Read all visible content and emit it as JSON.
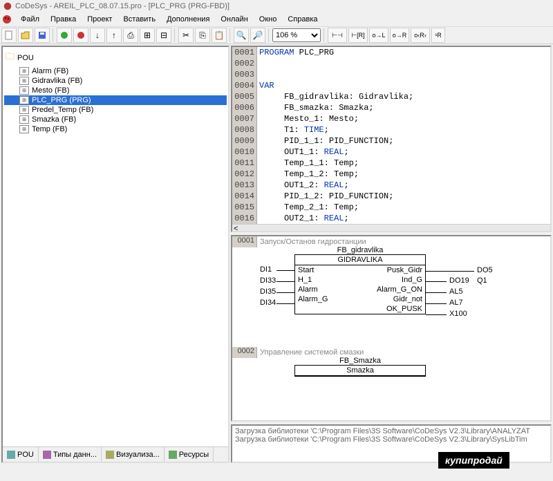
{
  "title": "CoDeSys - AREIL_PLC_08.07.15.pro - [PLC_PRG (PRG-FBD)]",
  "menu": [
    "Файл",
    "Правка",
    "Проект",
    "Вставить",
    "Дополнения",
    "Онлайн",
    "Окно",
    "Справка"
  ],
  "zoom": "106 %",
  "tree": {
    "root": "POU",
    "items": [
      "Alarm (FB)",
      "Gidravlika (FB)",
      "Mesto (FB)",
      "PLC_PRG (PRG)",
      "Predel_Temp (FB)",
      "Smazka (FB)",
      "Temp (FB)"
    ],
    "selected": 3
  },
  "btabs": [
    "POU",
    "Типы данн...",
    "Визуализа...",
    "Ресурсы"
  ],
  "code": [
    {
      "n": "0001",
      "tokens": [
        {
          "t": "PROGRAM",
          "c": "kw"
        },
        {
          "t": " PLC_PRG",
          "c": "tx"
        }
      ]
    },
    {
      "n": "0002",
      "tokens": []
    },
    {
      "n": "0003",
      "tokens": []
    },
    {
      "n": "0004",
      "tokens": [
        {
          "t": "VAR",
          "c": "kw"
        }
      ]
    },
    {
      "n": "0005",
      "tokens": [
        {
          "t": "     FB_gidravlika: Gidravlika;",
          "c": "tx"
        }
      ]
    },
    {
      "n": "0006",
      "tokens": [
        {
          "t": "     FB_smazka: Smazka;",
          "c": "tx"
        }
      ]
    },
    {
      "n": "0007",
      "tokens": [
        {
          "t": "     Mesto_1: Mesto;",
          "c": "tx"
        }
      ]
    },
    {
      "n": "0008",
      "tokens": [
        {
          "t": "     T1: ",
          "c": "tx"
        },
        {
          "t": "TIME",
          "c": "ty"
        },
        {
          "t": ";",
          "c": "tx"
        }
      ]
    },
    {
      "n": "0009",
      "tokens": [
        {
          "t": "     PID_1_1: PID_FUNCTION;",
          "c": "tx"
        }
      ]
    },
    {
      "n": "0010",
      "tokens": [
        {
          "t": "     OUT1_1: ",
          "c": "tx"
        },
        {
          "t": "REAL",
          "c": "ty"
        },
        {
          "t": ";",
          "c": "tx"
        }
      ]
    },
    {
      "n": "0011",
      "tokens": [
        {
          "t": "     Temp_1_1: Temp;",
          "c": "tx"
        }
      ]
    },
    {
      "n": "0012",
      "tokens": [
        {
          "t": "     Temp_1_2: Temp;",
          "c": "tx"
        }
      ]
    },
    {
      "n": "0013",
      "tokens": [
        {
          "t": "     OUT1_2: ",
          "c": "tx"
        },
        {
          "t": "REAL",
          "c": "ty"
        },
        {
          "t": ";",
          "c": "tx"
        }
      ]
    },
    {
      "n": "0014",
      "tokens": [
        {
          "t": "     PID_1_2: PID_FUNCTION;",
          "c": "tx"
        }
      ]
    },
    {
      "n": "0015",
      "tokens": [
        {
          "t": "     Temp_2_1: Temp;",
          "c": "tx"
        }
      ]
    },
    {
      "n": "0016",
      "tokens": [
        {
          "t": "     OUT2_1: ",
          "c": "tx"
        },
        {
          "t": "REAL",
          "c": "ty"
        },
        {
          "t": ";",
          "c": "tx"
        }
      ]
    }
  ],
  "fbd": {
    "net1": {
      "num": "0001",
      "title": "Запуск/Останов гидростанции",
      "instance": "FB_gidravlika",
      "type": "GIDRAVLIKA",
      "left_io": [
        [
          "DI1",
          "Start"
        ],
        [
          "DI33",
          "H_1"
        ],
        [
          "DI35",
          "Alarm"
        ],
        [
          "DI34",
          "Alarm_G"
        ]
      ],
      "right_io": [
        [
          "Pusk_Gidr",
          ""
        ],
        [
          "Ind_G",
          "DO19"
        ],
        [
          "Alarm_G_ON",
          "AL5"
        ],
        [
          "Gidr_not",
          "AL7"
        ],
        [
          "OK_PUSK",
          "X100"
        ]
      ],
      "out_chain": [
        "DO5",
        "Q1"
      ]
    },
    "net2": {
      "num": "0002",
      "title": "Управление системой смазки",
      "instance": "FB_Smazka",
      "type": "Smazka"
    }
  },
  "log": [
    "Загрузка библиотеки 'C:\\Program Files\\3S Software\\CoDeSys V2.3\\Library\\ANALYZAT",
    "Загрузка библиотеки 'C:\\Program Files\\3S Software\\CoDeSys V2.3\\Library\\SysLibTim"
  ],
  "watermark": "купипродай"
}
